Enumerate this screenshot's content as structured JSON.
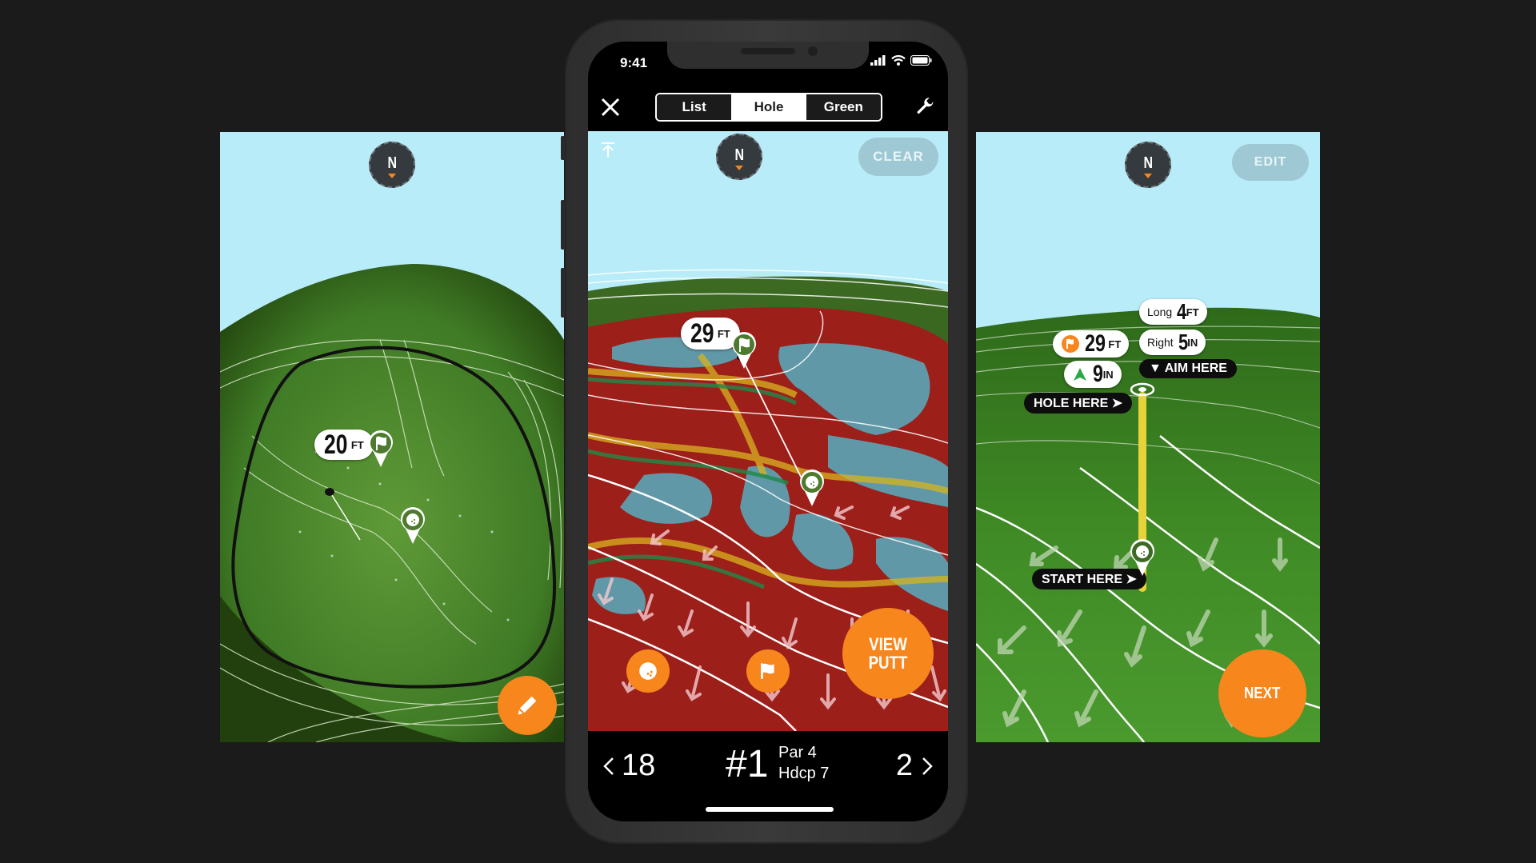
{
  "left_panel": {
    "compass_label": "N",
    "distance": {
      "value": "20",
      "unit": "FT"
    },
    "edit_icon": "pencil-icon"
  },
  "phone": {
    "status_bar": {
      "time": "9:41",
      "icons": [
        "signal-icon",
        "wifi-icon",
        "battery-icon"
      ]
    },
    "nav": {
      "close_icon": "close-icon",
      "tabs": [
        {
          "label": "List",
          "active": false
        },
        {
          "label": "Hole",
          "active": true
        },
        {
          "label": "Green",
          "active": false
        }
      ],
      "settings_icon": "wrench-icon"
    },
    "map": {
      "compass_label": "N",
      "clear_label": "CLEAR",
      "distance": {
        "value": "29",
        "unit": "FT"
      },
      "view_putt_label": "VIEW PUTT",
      "ball_button_icon": "golf-ball-icon",
      "flag_button_icon": "flag-icon"
    },
    "hole_bar": {
      "prev_hole": "18",
      "current_hole": "#1",
      "par": "Par 4",
      "handicap": "Hdcp 7",
      "next_hole": "2"
    }
  },
  "right_panel": {
    "compass_label": "N",
    "edit_label": "EDIT",
    "flag_distance": {
      "value": "29",
      "unit": "FT"
    },
    "elevation": {
      "value": "9",
      "unit": "IN"
    },
    "long": {
      "label": "Long",
      "value": "4",
      "unit": "FT"
    },
    "right": {
      "label": "Right",
      "value": "5",
      "unit": "IN"
    },
    "aim_here": "AIM HERE",
    "hole_here": "HOLE HERE",
    "start_here": "START HERE",
    "next_label": "NEXT"
  }
}
